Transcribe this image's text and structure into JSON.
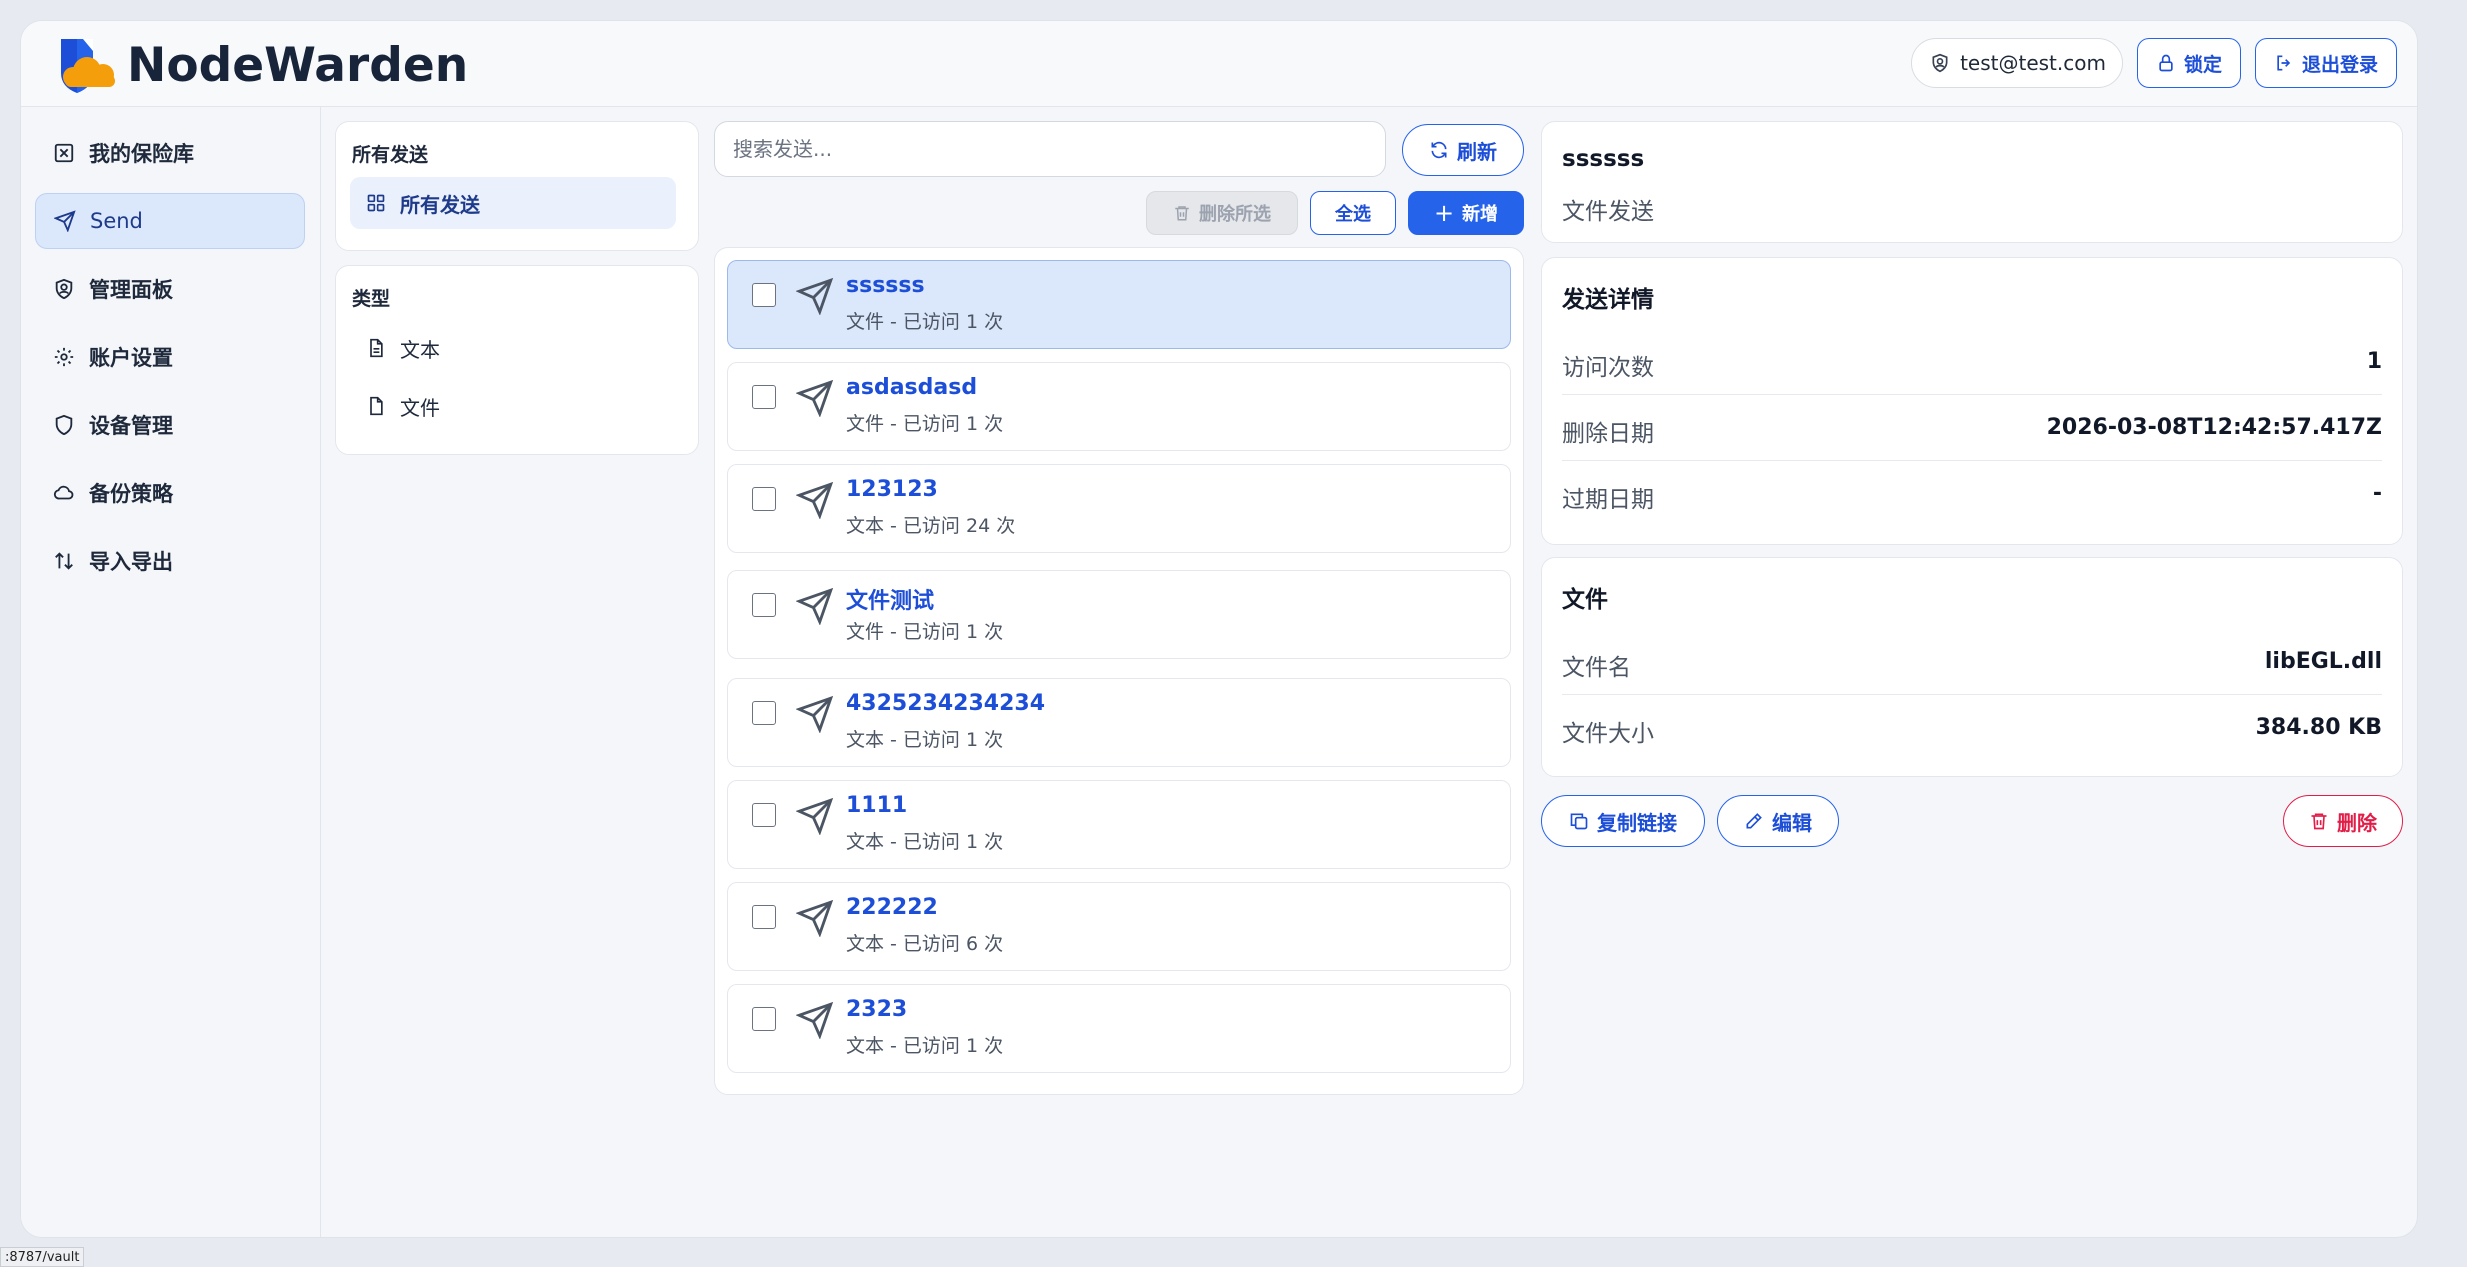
{
  "app": {
    "name": "NodeWarden"
  },
  "header": {
    "user_email": "test@test.com",
    "lock_label": "锁定",
    "logout_label": "退出登录"
  },
  "sidebar": {
    "items": [
      {
        "label": "我的保险库",
        "icon": "vault-icon"
      },
      {
        "label": "Send",
        "icon": "send-icon",
        "active": true
      },
      {
        "label": "管理面板",
        "icon": "shield-user-icon"
      },
      {
        "label": "账户设置",
        "icon": "gear-icon"
      },
      {
        "label": "设备管理",
        "icon": "shield-icon"
      },
      {
        "label": "备份策略",
        "icon": "cloud-icon"
      },
      {
        "label": "导入导出",
        "icon": "arrows-up-down-icon"
      }
    ]
  },
  "filters": {
    "all_title": "所有发送",
    "all_item": "所有发送",
    "type_title": "类型",
    "types": [
      {
        "label": "文本",
        "icon": "text-file-icon"
      },
      {
        "label": "文件",
        "icon": "file-icon"
      }
    ]
  },
  "toolbar": {
    "search_placeholder": "搜索发送...",
    "refresh_label": "刷新",
    "delete_selected_label": "删除所选",
    "select_all_label": "全选",
    "new_label": "新增"
  },
  "sends": [
    {
      "name": "ssssss",
      "meta": "文件 - 已访问 1 次",
      "selected": true
    },
    {
      "name": "asdasdasd",
      "meta": "文件 - 已访问 1 次"
    },
    {
      "name": "123123",
      "meta": "文本 - 已访问 24 次"
    },
    {
      "name": "文件测试",
      "meta": "文件 - 已访问 1 次"
    },
    {
      "name": "4325234234234",
      "meta": "文本 - 已访问 1 次"
    },
    {
      "name": "1111",
      "meta": "文本 - 已访问 1 次"
    },
    {
      "name": "222222",
      "meta": "文本 - 已访问 6 次"
    },
    {
      "name": "2323",
      "meta": "文本 - 已访问 1 次"
    }
  ],
  "detail": {
    "name": "ssssss",
    "kind": "文件发送",
    "send_details_title": "发送详情",
    "access_count_label": "访问次数",
    "access_count_value": "1",
    "deletion_date_label": "删除日期",
    "deletion_date_value": "2026-03-08T12:42:57.417Z",
    "expiration_date_label": "过期日期",
    "expiration_date_value": "-",
    "file_title": "文件",
    "file_name_label": "文件名",
    "file_name_value": "libEGL.dll",
    "file_size_label": "文件大小",
    "file_size_value": "384.80 KB",
    "copy_link_label": "复制链接",
    "edit_label": "编辑",
    "delete_label": "删除"
  },
  "status_bar": {
    "url": ":8787/vault"
  },
  "colors": {
    "accent": "#2563eb",
    "danger": "#e11d48",
    "selected_bg": "#dbe7fb",
    "logo_orange": "#f59e0b",
    "logo_blue": "#1d4ed8"
  }
}
